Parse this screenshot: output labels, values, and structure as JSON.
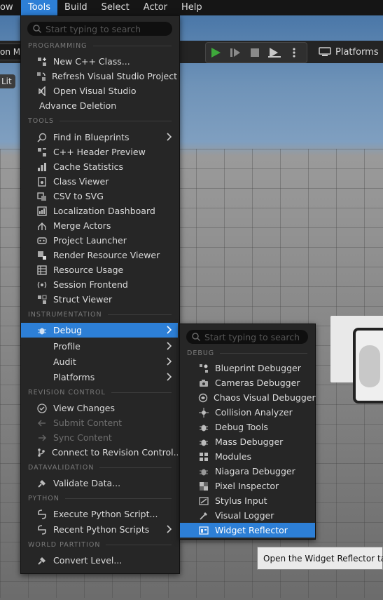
{
  "menubar": {
    "items": [
      {
        "label": "ow",
        "active": false
      },
      {
        "label": "Tools",
        "active": true
      },
      {
        "label": "Build",
        "active": false
      },
      {
        "label": "Select",
        "active": false
      },
      {
        "label": "Actor",
        "active": false
      },
      {
        "label": "Help",
        "active": false
      }
    ]
  },
  "background": {
    "mode_label": "on Mo",
    "lit_label": "Lit",
    "platforms_label": "Platforms"
  },
  "tools_menu": {
    "search_placeholder": "Start typing to search",
    "sections": {
      "programming": "PROGRAMMING",
      "tools": "TOOLS",
      "instrumentation": "INSTRUMENTATION",
      "revision_control": "REVISION CONTROL",
      "datavalidation": "DATAVALIDATION",
      "python": "PYTHON",
      "world_partition": "WORLD PARTITION"
    },
    "items": [
      {
        "label": "New C++ Class...",
        "icon": "add-class-icon"
      },
      {
        "label": "Refresh Visual Studio Project",
        "icon": "refresh-icon"
      },
      {
        "label": "Open Visual Studio",
        "icon": "visual-studio-icon"
      },
      {
        "label": "Advance Deletion",
        "icon": "none"
      },
      {
        "label": "Find in Blueprints",
        "icon": "find-icon",
        "submenu": true
      },
      {
        "label": "C++ Header Preview",
        "icon": "header-preview-icon"
      },
      {
        "label": "Cache Statistics",
        "icon": "stats-icon"
      },
      {
        "label": "Class Viewer",
        "icon": "class-viewer-icon"
      },
      {
        "label": "CSV to SVG",
        "icon": "csv-icon"
      },
      {
        "label": "Localization Dashboard",
        "icon": "localization-icon"
      },
      {
        "label": "Merge Actors",
        "icon": "merge-icon"
      },
      {
        "label": "Project Launcher",
        "icon": "launcher-icon"
      },
      {
        "label": "Render Resource Viewer",
        "icon": "render-resource-icon"
      },
      {
        "label": "Resource Usage",
        "icon": "table-icon"
      },
      {
        "label": "Session Frontend",
        "icon": "session-icon"
      },
      {
        "label": "Struct Viewer",
        "icon": "struct-icon"
      },
      {
        "label": "Debug",
        "icon": "bug-icon",
        "submenu": true,
        "selected": true
      },
      {
        "label": "Profile",
        "icon": "none",
        "submenu": true
      },
      {
        "label": "Audit",
        "icon": "none",
        "submenu": true
      },
      {
        "label": "Platforms",
        "icon": "none",
        "submenu": true
      },
      {
        "label": "View Changes",
        "icon": "check-circle-icon"
      },
      {
        "label": "Submit Content",
        "icon": "arrow-left-icon",
        "disabled": true
      },
      {
        "label": "Sync Content",
        "icon": "arrow-right-icon",
        "disabled": true
      },
      {
        "label": "Connect to Revision Control...",
        "icon": "branch-icon"
      },
      {
        "label": "Validate Data...",
        "icon": "validate-icon"
      },
      {
        "label": "Execute Python Script...",
        "icon": "python-icon"
      },
      {
        "label": "Recent Python Scripts",
        "icon": "python-recent-icon",
        "submenu": true
      },
      {
        "label": "Convert Level...",
        "icon": "convert-icon"
      }
    ]
  },
  "debug_menu": {
    "search_placeholder": "Start typing to search",
    "section": "DEBUG",
    "items": [
      {
        "label": "Blueprint Debugger",
        "icon": "blueprint-debug-icon"
      },
      {
        "label": "Cameras Debugger",
        "icon": "camera-icon"
      },
      {
        "label": "Chaos Visual Debugger",
        "icon": "chaos-icon"
      },
      {
        "label": "Collision Analyzer",
        "icon": "collision-icon"
      },
      {
        "label": "Debug Tools",
        "icon": "bug-icon"
      },
      {
        "label": "Mass Debugger",
        "icon": "mass-icon"
      },
      {
        "label": "Modules",
        "icon": "modules-icon"
      },
      {
        "label": "Niagara Debugger",
        "icon": "niagara-icon"
      },
      {
        "label": "Pixel Inspector",
        "icon": "pixel-icon"
      },
      {
        "label": "Stylus Input",
        "icon": "stylus-icon"
      },
      {
        "label": "Visual Logger",
        "icon": "logger-icon"
      },
      {
        "label": "Widget Reflector",
        "icon": "widget-reflector-icon",
        "selected": true
      }
    ]
  },
  "tooltip": {
    "text": "Open the Widget Reflector tab."
  },
  "colors": {
    "accent": "#2d7fd6",
    "menu_bg": "#262626",
    "play_green": "#3ea83b"
  }
}
